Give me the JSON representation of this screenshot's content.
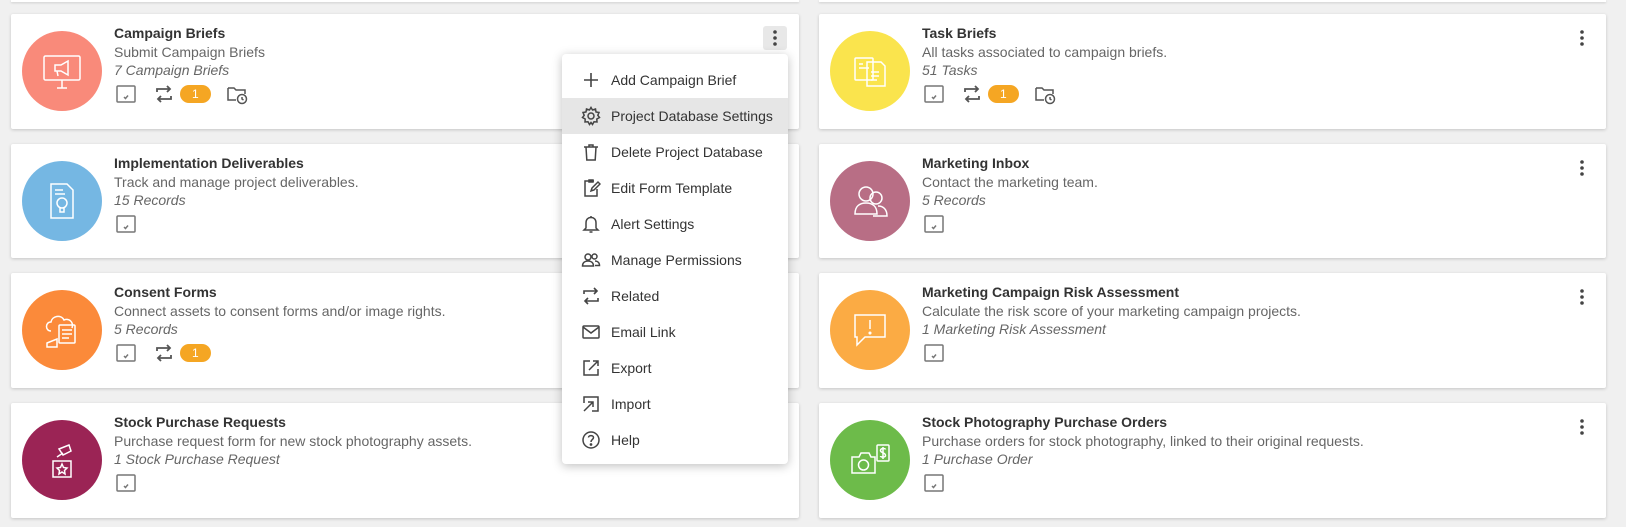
{
  "cards": [
    {
      "title": "Campaign Briefs",
      "subtitle": "Submit Campaign Briefs",
      "count": "7 Campaign Briefs",
      "badge": "1",
      "color": "#f98a7a"
    },
    {
      "title": "Task Briefs",
      "subtitle": "All tasks associated to campaign briefs.",
      "count": "51 Tasks",
      "badge": "1",
      "color": "#fae44d"
    },
    {
      "title": "Implementation Deliverables",
      "subtitle": "Track and manage project deliverables.",
      "count": "15 Records",
      "color": "#75b7e3"
    },
    {
      "title": "Marketing Inbox",
      "subtitle": "Contact the marketing team.",
      "count": "5 Records",
      "color": "#b86e85"
    },
    {
      "title": "Consent Forms",
      "subtitle": "Connect assets to consent forms and/or image rights.",
      "count": "5 Records",
      "badge": "1",
      "color": "#fb8a3a"
    },
    {
      "title": "Marketing Campaign Risk Assessment",
      "subtitle": "Calculate the risk score of your marketing campaign projects.",
      "count": "1 Marketing Risk Assessment",
      "color": "#fbab44"
    },
    {
      "title": "Stock Purchase Requests",
      "subtitle": "Purchase request form for new stock photography assets.",
      "count": "1 Stock Purchase Request",
      "color": "#9b2455"
    },
    {
      "title": "Stock Photography Purchase Orders",
      "subtitle": "Purchase orders for stock photography, linked to their original requests.",
      "count": "1 Purchase Order",
      "color": "#6dbb4a"
    }
  ],
  "menu": {
    "items": [
      {
        "label": "Add Campaign Brief",
        "icon": "plus-icon"
      },
      {
        "label": "Project Database Settings",
        "icon": "gear-icon"
      },
      {
        "label": "Delete Project Database",
        "icon": "trash-icon"
      },
      {
        "label": "Edit Form Template",
        "icon": "edit-form-icon"
      },
      {
        "label": "Alert Settings",
        "icon": "bell-icon"
      },
      {
        "label": "Manage Permissions",
        "icon": "people-icon"
      },
      {
        "label": "Related",
        "icon": "repeat-icon"
      },
      {
        "label": "Email Link",
        "icon": "envelope-icon"
      },
      {
        "label": "Export",
        "icon": "export-icon"
      },
      {
        "label": "Import",
        "icon": "import-icon"
      },
      {
        "label": "Help",
        "icon": "help-icon"
      }
    ]
  }
}
